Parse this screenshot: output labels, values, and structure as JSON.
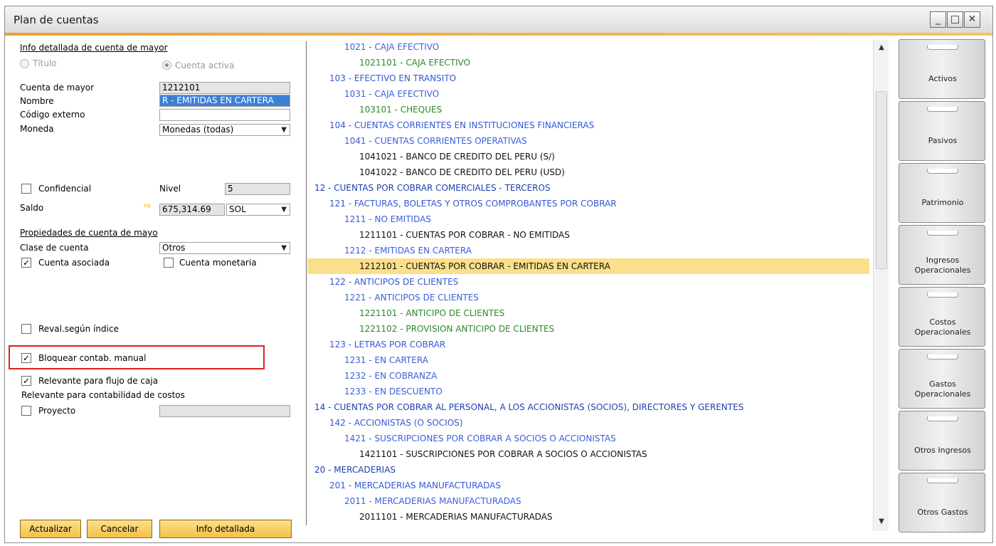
{
  "window": {
    "title": "Plan de cuentas",
    "controls": {
      "minimize": "_",
      "maximize": "□",
      "close": "✕"
    }
  },
  "details": {
    "section_title": "Info detallada de cuenta de mayor",
    "radio_title": "Título",
    "radio_active": "Cuenta activa",
    "labels": {
      "cuenta_mayor": "Cuenta de mayor",
      "nombre": "Nombre",
      "codigo_externo": "Código externo",
      "moneda": "Moneda",
      "confidencial": "Confidencial",
      "nivel": "Nivel",
      "saldo": "Saldo"
    },
    "values": {
      "cuenta_mayor": "1212101",
      "nombre": "R - EMITIDAS EN CARTERA",
      "codigo_externo": "",
      "moneda": "Monedas (todas)",
      "nivel": "5",
      "saldo": "675,314.69",
      "saldo_moneda": "SOL"
    },
    "props_title": "Propiedades de cuenta de mayo",
    "clase_label": "Clase de cuenta",
    "clase_value": "Otros",
    "cuenta_asociada": "Cuenta asociada",
    "cuenta_monetaria": "Cuenta monetaria",
    "reval": "Reval.según índice",
    "bloquear": "Bloquear contab. manual",
    "relevante_flujo": "Relevante para flujo de caja",
    "relevante_costos": "Relevante para contabilidad de costos",
    "proyecto": "Proyecto",
    "check_mark": "✓",
    "arrow_symbol": "⇨"
  },
  "buttons": {
    "actualizar": "Actualizar",
    "cancelar": "Cancelar",
    "info": "Info detallada"
  },
  "tree": [
    {
      "text": "1021 - CAJA EFECTIVO",
      "indent": 3,
      "style": "lv2"
    },
    {
      "text": "1021101 - CAJA EFECTIVO",
      "indent": 4,
      "style": "green"
    },
    {
      "text": "103 - EFECTIVO EN TRANSITO",
      "indent": 2,
      "style": "lv1"
    },
    {
      "text": "1031 - CAJA EFECTIVO",
      "indent": 3,
      "style": "lv2"
    },
    {
      "text": "103101 - CHEQUES",
      "indent": 4,
      "style": "green"
    },
    {
      "text": "104 - CUENTAS CORRIENTES EN INSTITUCIONES FINANCIERAS",
      "indent": 2,
      "style": "lv1"
    },
    {
      "text": "1041 - CUENTAS CORRIENTES OPERATIVAS",
      "indent": 3,
      "style": "lv2"
    },
    {
      "text": "1041021 - BANCO DE CREDITO DEL PERU (S/)",
      "indent": 4,
      "style": "black"
    },
    {
      "text": "1041022 - BANCO DE CREDITO DEL PERU (USD)",
      "indent": 4,
      "style": "black"
    },
    {
      "text": "12 - CUENTAS POR COBRAR COMERCIALES - TERCEROS",
      "indent": 1,
      "style": "lv0"
    },
    {
      "text": "121 - FACTURAS, BOLETAS Y OTROS COMPROBANTES POR COBRAR",
      "indent": 2,
      "style": "lv1"
    },
    {
      "text": "1211 - NO EMITIDAS",
      "indent": 3,
      "style": "lv2"
    },
    {
      "text": "1211101 - CUENTAS POR COBRAR - NO EMITIDAS",
      "indent": 4,
      "style": "black"
    },
    {
      "text": "1212 - EMITIDAS EN CARTERA",
      "indent": 3,
      "style": "lv2"
    },
    {
      "text": "1212101 - CUENTAS POR COBRAR - EMITIDAS EN CARTERA",
      "indent": 4,
      "style": "black",
      "selected": true
    },
    {
      "text": "122 - ANTICIPOS DE CLIENTES",
      "indent": 2,
      "style": "lv1"
    },
    {
      "text": "1221 - ANTICIPOS DE CLIENTES",
      "indent": 3,
      "style": "lv2"
    },
    {
      "text": "1221101 - ANTICIPO DE CLIENTES",
      "indent": 4,
      "style": "green"
    },
    {
      "text": "1221102 - PROVISION ANTICIPO DE CLIENTES",
      "indent": 4,
      "style": "green"
    },
    {
      "text": "123 - LETRAS POR COBRAR",
      "indent": 2,
      "style": "lv1"
    },
    {
      "text": "1231 - EN CARTERA",
      "indent": 3,
      "style": "lv2"
    },
    {
      "text": "1232 - EN COBRANZA",
      "indent": 3,
      "style": "lv2"
    },
    {
      "text": "1233 - EN DESCUENTO",
      "indent": 3,
      "style": "lv2"
    },
    {
      "text": "14 - CUENTAS POR COBRAR AL PERSONAL, A LOS ACCIONISTAS (SOCIOS), DIRECTORES Y GERENTES",
      "indent": 1,
      "style": "lv0"
    },
    {
      "text": "142 - ACCIONISTAS (O SOCIOS)",
      "indent": 2,
      "style": "lv1"
    },
    {
      "text": "1421 - SUSCRIPCIONES POR COBRAR A SOCIOS O ACCIONISTAS",
      "indent": 3,
      "style": "lv2"
    },
    {
      "text": "1421101 - SUSCRIPCIONES POR COBRAR A SOCIOS O ACCIONISTAS",
      "indent": 4,
      "style": "black"
    },
    {
      "text": "20 - MERCADERIAS",
      "indent": 1,
      "style": "lv0"
    },
    {
      "text": "201 - MERCADERIAS MANUFACTURADAS",
      "indent": 2,
      "style": "lv1"
    },
    {
      "text": "2011 - MERCADERIAS MANUFACTURADAS",
      "indent": 3,
      "style": "lv2"
    },
    {
      "text": "2011101 - MERCADERIAS MANUFACTURADAS",
      "indent": 4,
      "style": "black"
    }
  ],
  "scroll": {
    "up": "▲",
    "down": "▼"
  },
  "tabs": [
    {
      "line1": "Activos",
      "line2": ""
    },
    {
      "line1": "Pasivos",
      "line2": ""
    },
    {
      "line1": "Patrimonio",
      "line2": ""
    },
    {
      "line1": "Ingresos",
      "line2": "Operacionales"
    },
    {
      "line1": "Costos",
      "line2": "Operacionales"
    },
    {
      "line1": "Gastos",
      "line2": "Operacionales"
    },
    {
      "line1": "Otros Ingresos",
      "line2": ""
    },
    {
      "line1": "Otros Gastos",
      "line2": ""
    }
  ]
}
